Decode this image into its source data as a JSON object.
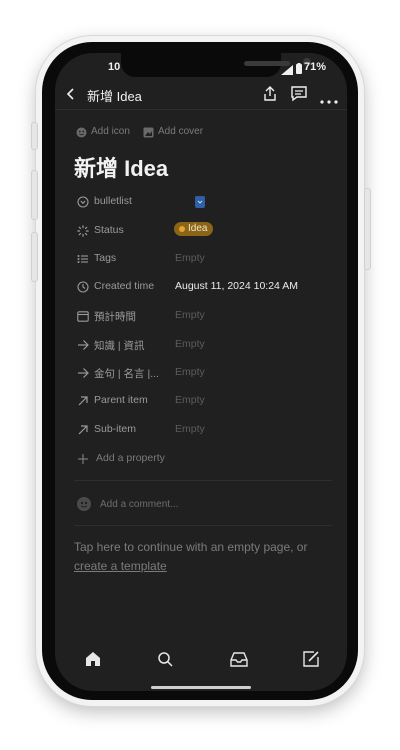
{
  "status_bar": {
    "time": "10",
    "battery": "71%"
  },
  "header": {
    "title": "新增 Idea",
    "back_icon": "chevron-left-icon",
    "share_icon": "share-icon",
    "comments_icon": "comment-icon",
    "more_icon": "more-horizontal-icon"
  },
  "page_actions": {
    "add_icon": "Add icon",
    "add_cover": "Add cover"
  },
  "page_title": "新增 Idea",
  "properties": [
    {
      "name": "bulletlist",
      "value": "",
      "icon": "select-icon"
    },
    {
      "name": "Status",
      "value": "Idea",
      "icon": "status-icon"
    },
    {
      "name": "Tags",
      "value": "Empty",
      "icon": "list-icon"
    },
    {
      "name": "Created time",
      "value": "August 11, 2024 10:24 AM",
      "icon": "clock-icon"
    },
    {
      "name": "預計時間",
      "value": "Empty",
      "icon": "calendar-icon"
    },
    {
      "name": "知識 | 資訊",
      "value": "Empty",
      "icon": "relation-arrow-icon"
    },
    {
      "name": "金句 | 名言 |...",
      "value": "Empty",
      "icon": "relation-arrow-icon"
    },
    {
      "name": "Parent item",
      "value": "Empty",
      "icon": "arrow-up-right-icon"
    },
    {
      "name": "Sub-item",
      "value": "Empty",
      "icon": "arrow-up-right-icon"
    }
  ],
  "add_property": "Add a property",
  "comment_placeholder": "Add a comment...",
  "empty_page_prompt": "Tap here to continue with an empty page, or",
  "create_template": "create a template",
  "tabbar": [
    "home-icon",
    "search-icon",
    "inbox-icon",
    "compose-icon"
  ],
  "colors": {
    "background": "#202020",
    "status_pill": "#8a6418",
    "status_dot": "#e7a52b",
    "select_chip": "#2f5fa6"
  }
}
